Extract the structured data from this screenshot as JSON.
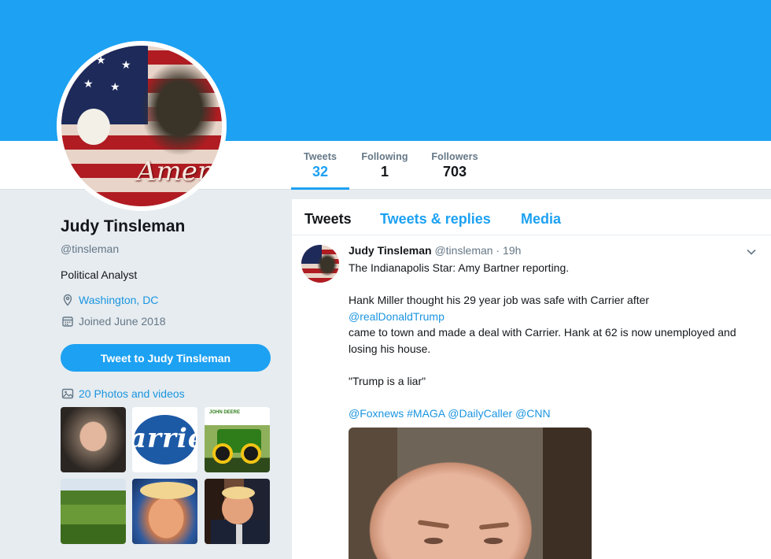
{
  "profile": {
    "name": "Judy Tinsleman",
    "handle": "@tinsleman",
    "bio": "Political Analyst",
    "location": "Washington, DC",
    "joined": "Joined June 2018",
    "tweet_to_label": "Tweet to Judy Tinsleman",
    "photos_label": "20 Photos and videos",
    "avatar_text": "Ameri"
  },
  "stats": [
    {
      "label": "Tweets",
      "value": "32"
    },
    {
      "label": "Following",
      "value": "1"
    },
    {
      "label": "Followers",
      "value": "703"
    }
  ],
  "tabs": [
    "Tweets",
    "Tweets & replies",
    "Media"
  ],
  "tweet": {
    "name": "Judy Tinsleman",
    "handle": "@tinsleman",
    "separator": "·",
    "time": "19h",
    "line1": "The Indianapolis Star: Amy Bartner reporting.",
    "line2": "Hank Miller thought his 29 year job was safe with Carrier after",
    "mention": "@realDonaldTrump",
    "line3": "came to town and made a deal with Carrier. Hank at 62 is now unemployed and losing his house.",
    "quote": "\"Trump is a liar\"",
    "tags": [
      "@Foxnews",
      "#MAGA",
      "@DailyCaller",
      "@CNN"
    ]
  },
  "thumbs": {
    "carrier_text": "arrie",
    "deere_text": "JOHN DEERE"
  },
  "colors": {
    "brand": "#1da1f2",
    "link": "#1b95e0",
    "muted": "#657786",
    "background": "#e6ecf0"
  },
  "icons": {
    "location": "location-pin-icon",
    "calendar": "calendar-icon",
    "photos": "image-icon",
    "caret": "chevron-down-icon"
  }
}
